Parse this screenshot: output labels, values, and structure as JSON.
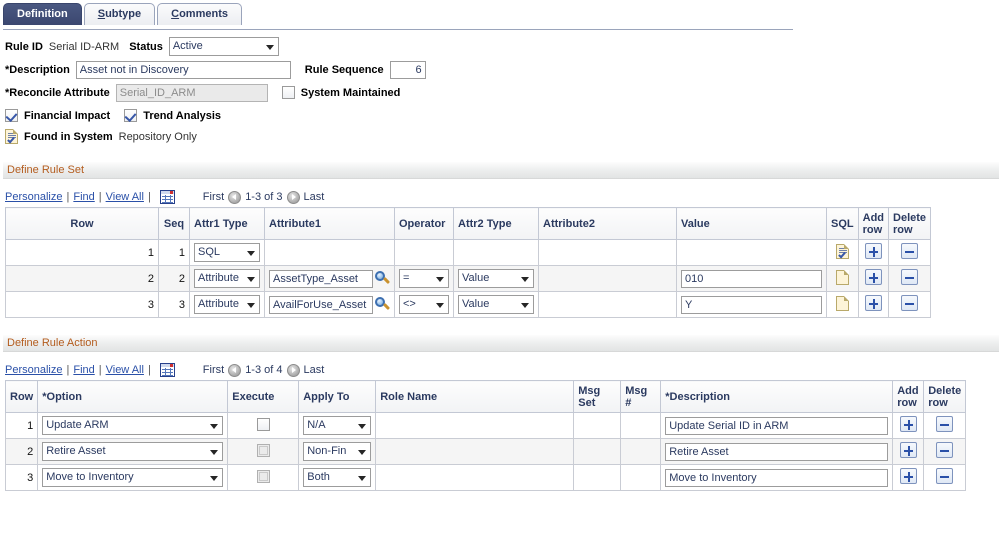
{
  "tabs": [
    {
      "label": "Definition",
      "accel": "D",
      "active": true
    },
    {
      "label": "Subtype",
      "accel": "S",
      "active": false
    },
    {
      "label": "Comments",
      "accel": "C",
      "active": false
    }
  ],
  "header": {
    "rule_id_label": "Rule ID",
    "rule_id_value": "Serial ID-ARM",
    "status_label": "Status",
    "status_value": "Active",
    "description_label": "*Description",
    "description_value": "Asset not in Discovery",
    "rule_sequence_label": "Rule Sequence",
    "rule_sequence_value": "6",
    "reconcile_attribute_label": "*Reconcile Attribute",
    "reconcile_attribute_value": "Serial_ID_ARM",
    "system_maintained_label": "System Maintained",
    "system_maintained_checked": false,
    "financial_impact_label": "Financial Impact",
    "financial_impact_checked": true,
    "trend_analysis_label": "Trend Analysis",
    "trend_analysis_checked": true,
    "found_in_system_label": "Found in System",
    "found_in_system_value": "Repository Only"
  },
  "rule_set": {
    "section_title": "Define Rule Set",
    "toolbar": {
      "personalize": "Personalize",
      "find": "Find",
      "view_all": "View All",
      "first": "First",
      "range": "1-3 of 3",
      "last": "Last"
    },
    "columns": [
      "Row",
      "Seq",
      "Attr1 Type",
      "Attribute1",
      "Operator",
      "Attr2 Type",
      "Attribute2",
      "Value",
      "SQL",
      "Add row",
      "Delete row"
    ],
    "rows": [
      {
        "row": "1",
        "seq": "1",
        "attr1_type": "SQL",
        "attribute1": "",
        "operator": "",
        "attr2_type": "",
        "attribute2": "",
        "value": "",
        "sql_icon": "sql-defined-icon"
      },
      {
        "row": "2",
        "seq": "2",
        "attr1_type": "Attribute",
        "attribute1": "AssetType_Asset",
        "operator": "=",
        "attr2_type": "Value",
        "attribute2": "",
        "value": "010",
        "sql_icon": "sql-blank-icon"
      },
      {
        "row": "3",
        "seq": "3",
        "attr1_type": "Attribute",
        "attribute1": "AvailForUse_Asset",
        "operator": "<>",
        "attr2_type": "Value",
        "attribute2": "",
        "value": "Y",
        "sql_icon": "sql-blank-icon"
      }
    ]
  },
  "rule_action": {
    "section_title": "Define Rule Action",
    "toolbar": {
      "personalize": "Personalize",
      "find": "Find",
      "view_all": "View All",
      "first": "First",
      "range": "1-3 of 4",
      "last": "Last"
    },
    "columns": [
      "Row",
      "*Option",
      "Execute",
      "Apply To",
      "Role Name",
      "Msg Set",
      "Msg #",
      "*Description",
      "Add row",
      "Delete row"
    ],
    "rows": [
      {
        "row": "1",
        "option": "Update ARM",
        "execute_checked": false,
        "execute_disabled": false,
        "apply_to": "N/A",
        "role_name": "",
        "msg_set": "",
        "msg_num": "",
        "description": "Update Serial ID in ARM"
      },
      {
        "row": "2",
        "option": "Retire Asset",
        "execute_checked": false,
        "execute_disabled": true,
        "apply_to": "Non-Fin",
        "role_name": "",
        "msg_set": "",
        "msg_num": "",
        "description": "Retire Asset"
      },
      {
        "row": "3",
        "option": "Move to Inventory",
        "execute_checked": false,
        "execute_disabled": true,
        "apply_to": "Both",
        "role_name": "",
        "msg_set": "",
        "msg_num": "",
        "description": "Move to Inventory"
      }
    ]
  },
  "colors": {
    "tab_active_bg": "#3b4770",
    "section_text": "#b35c1e",
    "link": "#2a50a8",
    "header_text": "#2b3a60"
  }
}
